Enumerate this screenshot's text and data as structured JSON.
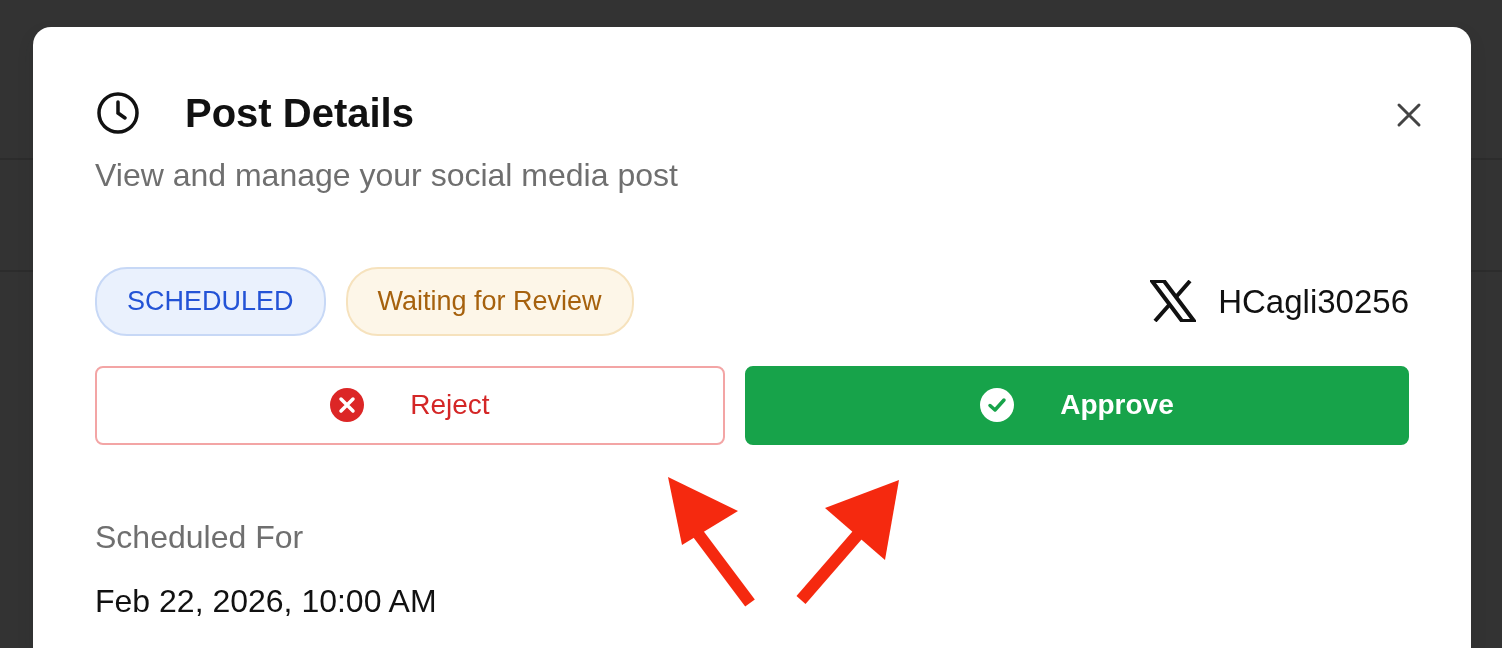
{
  "dialog": {
    "title": "Post Details",
    "subtitle": "View and manage your social media post"
  },
  "badges": [
    {
      "label": "SCHEDULED",
      "kind": "status"
    },
    {
      "label": "Waiting for Review",
      "kind": "review"
    }
  ],
  "account": {
    "handle": "HCagli30256"
  },
  "buttons": [
    {
      "label": "Reject",
      "kind": "reject"
    },
    {
      "label": "Approve",
      "kind": "approve"
    }
  ],
  "schedule": {
    "label": "Scheduled For",
    "value": "Feb 22, 2026, 10:00 AM"
  }
}
